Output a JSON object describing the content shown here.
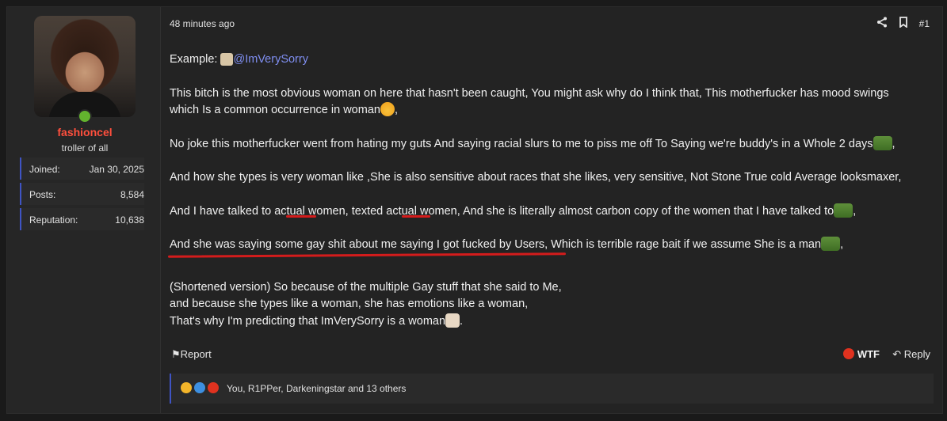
{
  "user": {
    "name": "fashioncel",
    "title": "troller of all",
    "stats": [
      {
        "label": "Joined:",
        "value": "Jan 30, 2025"
      },
      {
        "label": "Posts:",
        "value": "8,584"
      },
      {
        "label": "Reputation:",
        "value": "10,638"
      }
    ]
  },
  "post": {
    "time": "48 minutes ago",
    "number": "#1",
    "example_label": "Example:",
    "mention": "@ImVerySorry",
    "lines": [
      "This bitch is the most obvious woman on here that hasn't been caught, You might ask why do I think that, This motherfucker has mood swings",
      "which Is a common occurrence in woman",
      "No joke this motherfucker went from hating my guts And saying racial slurs to me to piss me off To Saying we're buddy's in a Whole 2 days",
      "And how she types is very woman like ,She is also sensitive about races that she likes, very sensitive, Not Stone True cold Average looksmaxer,",
      "And I have talked to actual women, texted actual women, And she is literally almost carbon copy of the women that I have talked to",
      "And she was saying some gay shit about me saying I got fucked by Users, Which is terrible rage bait if we assume She is a man",
      "(Shortened version) So because of the multiple Gay stuff that she said to Me,",
      "and because she types like a woman, she has emotions like a woman,",
      "That's why I'm predicting that ImVerySorry is a woman"
    ],
    "comma": ",",
    "period": ".",
    "report_label": "Report",
    "wtf_label": "WTF",
    "reply_label": "Reply",
    "reactions_text": "You, R1PPer, Darkeningstar and 13 others"
  },
  "colors": {
    "accent": "#3f54c4",
    "username": "#ff4f3d",
    "mention": "#7f8ef0",
    "online": "#63b32e",
    "markup": "#d41c1c"
  },
  "icons": [
    "share-icon",
    "bookmark-icon",
    "bell-icon",
    "angry-face-icon",
    "reply-icon",
    "laugh-react-icon",
    "like-react-icon",
    "angry-react-icon"
  ]
}
